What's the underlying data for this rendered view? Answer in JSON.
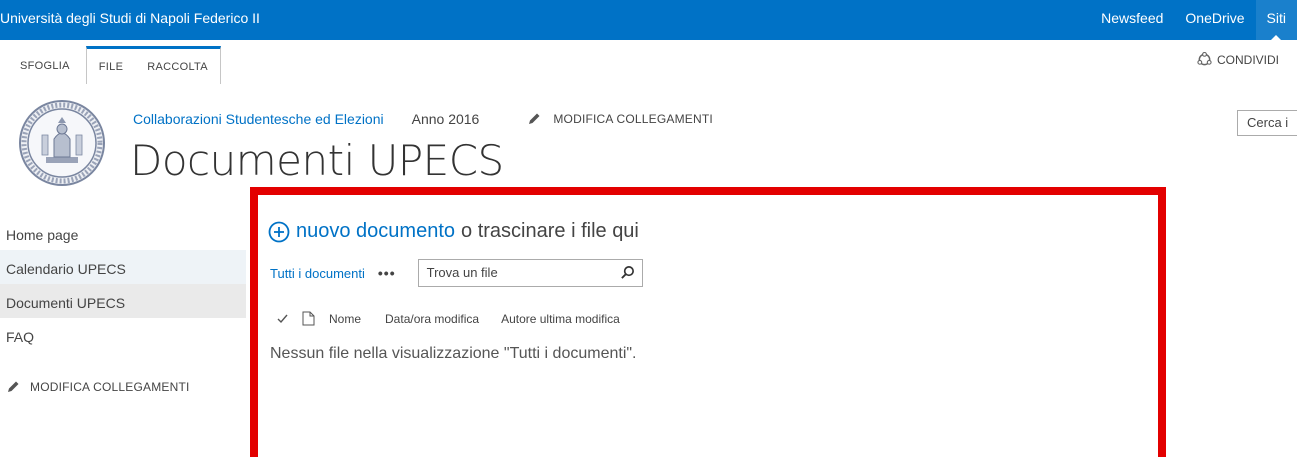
{
  "suite": {
    "title": "Università degli Studi di Napoli Federico II",
    "links": [
      "Newsfeed",
      "OneDrive",
      "Siti"
    ]
  },
  "ribbon": {
    "tabs": [
      "SFOGLIA",
      "FILE",
      "RACCOLTA"
    ],
    "share_label": "CONDIVIDI"
  },
  "header": {
    "breadcrumb_link": "Collaborazioni Studentesche ed Elezioni",
    "year": "Anno 2016",
    "edit_links": "MODIFICA COLLEGAMENTI",
    "title": "Documenti UPECS",
    "search_text": "Cerca i"
  },
  "leftnav": {
    "items": [
      "Home page",
      "Calendario UPECS",
      "Documenti UPECS",
      "FAQ"
    ],
    "edit_links": "MODIFICA COLLEGAMENTI"
  },
  "main": {
    "new_doc_link": "nuovo documento",
    "new_doc_rest": "o trascinare i file qui",
    "view_label": "Tutti i documenti",
    "ellipsis": "•••",
    "find_placeholder": "Trova un file",
    "columns": [
      "Nome",
      "Data/ora modifica",
      "Autore ultima modifica"
    ],
    "empty_message": "Nessun file nella visualizzazione \"Tutti i documenti\"."
  },
  "colors": {
    "suitebar": "#0072c6",
    "link": "#0072c6",
    "highlight_border": "#e30000"
  }
}
